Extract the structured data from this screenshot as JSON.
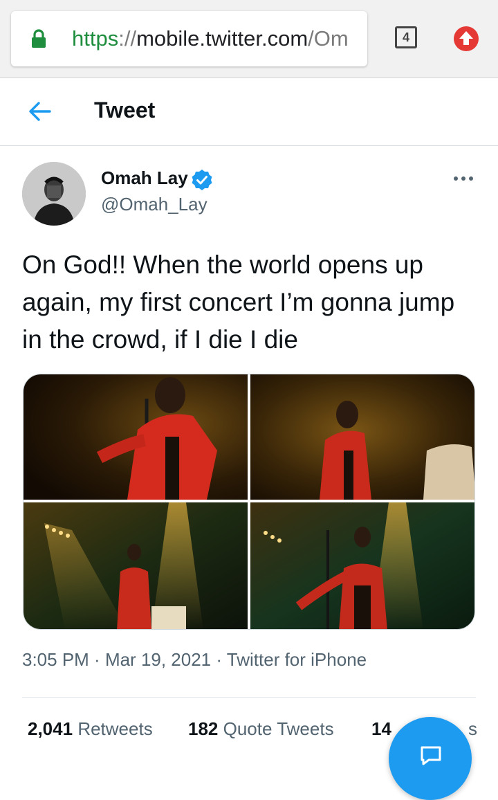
{
  "browser": {
    "url_scheme": "https",
    "url_sep": "://",
    "url_host": "mobile.twitter.com",
    "url_path": "/Om",
    "tab_count": "4"
  },
  "header": {
    "title": "Tweet"
  },
  "tweet": {
    "author_name": "Omah Lay",
    "author_handle": "@Omah_Lay",
    "text": "On God!! When the world opens up again, my first concert I’m gonna jump in the crowd, if I die I die",
    "time": "3:05 PM",
    "date": "Mar 19, 2021",
    "source": "Twitter for iPhone",
    "separator": " · "
  },
  "stats": {
    "retweets_count": "2,041",
    "retweets_label": "Retweets",
    "quotes_count": "182",
    "quotes_label": "Quote Tweets",
    "likes_count_visible": "14",
    "likes_label_visible": "s"
  },
  "colors": {
    "accent": "#1d9bf0",
    "lock_green": "#1e8e3e",
    "update_red": "#e53935",
    "secondary_text": "#536471"
  },
  "icons": {
    "lock": "lock-icon",
    "tabs": "tabs-icon",
    "update": "update-icon",
    "back": "back-arrow-icon",
    "verified": "verified-badge-icon",
    "more": "more-options-icon",
    "compose": "compose-icon"
  }
}
